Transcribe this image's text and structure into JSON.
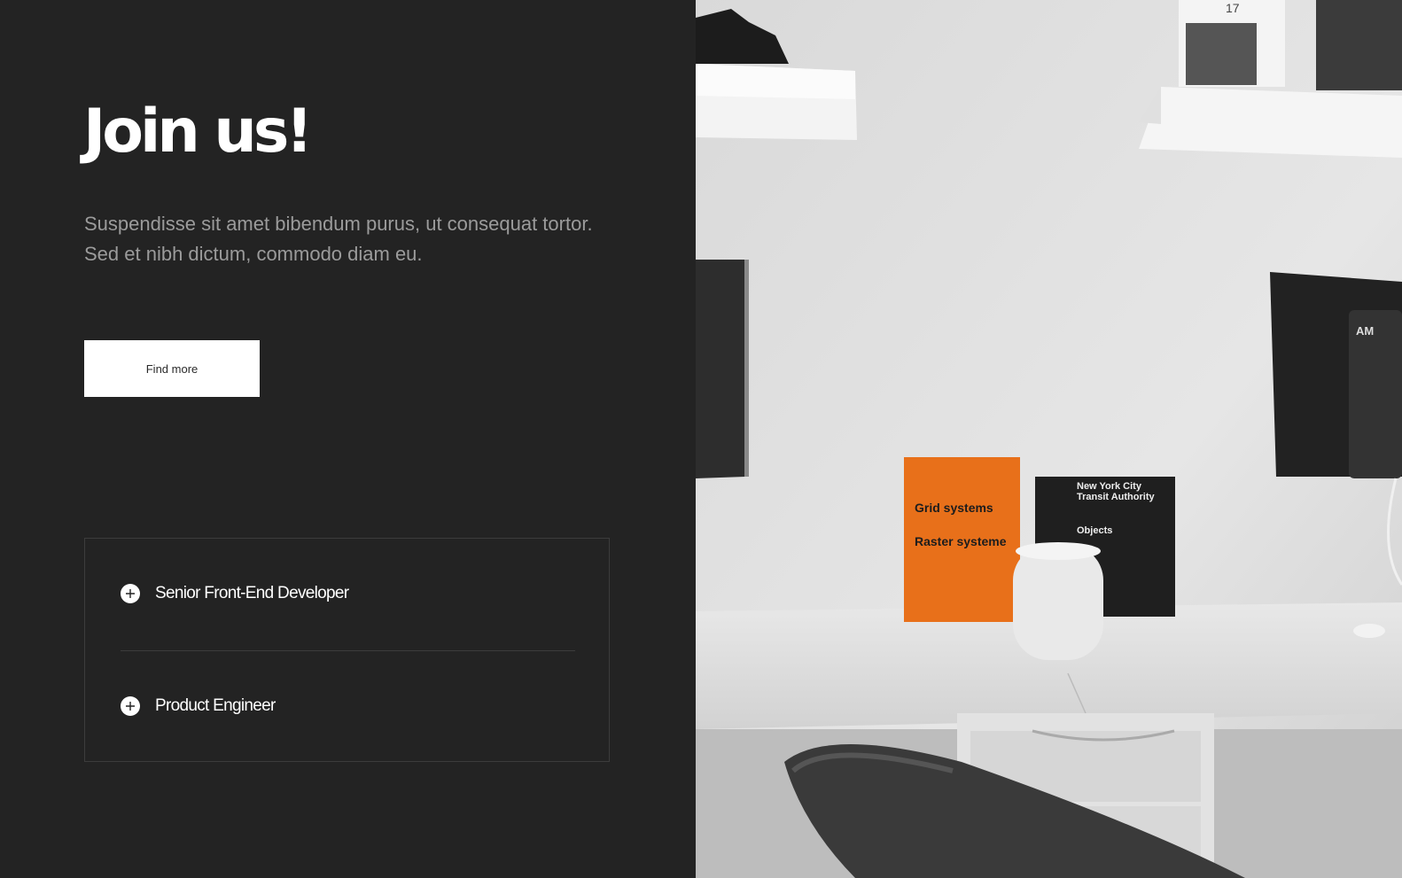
{
  "hero": {
    "title": "Join us!",
    "subtitle": "Suspendisse sit amet bibendum purus, ut consequat tortor. Sed et nibh dictum, commodo diam eu.",
    "cta_label": "Find more"
  },
  "jobs": [
    {
      "title": "Senior Front-End Developer",
      "icon": "plus-circle-icon"
    },
    {
      "title": "Product Engineer",
      "icon": "plus-circle-icon"
    }
  ],
  "photo": {
    "description_icon": "desk-photo",
    "book_orange": {
      "title1": "Grid systems",
      "title2": "Raster systeme"
    },
    "book_black": {
      "line1": "New York City",
      "line2": "Transit Authority",
      "line3": "Objects"
    },
    "clock_text": "AM",
    "frame_text": "17"
  },
  "colors": {
    "background": "#232323",
    "text_primary": "#ffffff",
    "text_secondary": "#9b9b9b",
    "button_bg": "#ffffff",
    "border": "#3c3c3c",
    "book_accent": "#e8701a"
  }
}
